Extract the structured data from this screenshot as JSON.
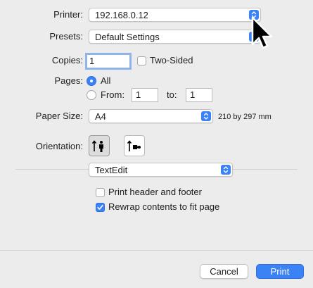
{
  "printer": {
    "label": "Printer:",
    "value": "192.168.0.12"
  },
  "presets": {
    "label": "Presets:",
    "value": "Default Settings"
  },
  "copies": {
    "label": "Copies:",
    "value": "1",
    "two_sided_label": "Two-Sided",
    "two_sided_checked": false
  },
  "pages": {
    "label": "Pages:",
    "all_label": "All",
    "from_label": "From:",
    "from_value": "1",
    "to_label": "to:",
    "to_value": "1",
    "selected": "All"
  },
  "paper_size": {
    "label": "Paper Size:",
    "value": "A4",
    "dimensions": "210 by 297 mm"
  },
  "orientation": {
    "label": "Orientation:",
    "selected": "portrait",
    "options": [
      "portrait",
      "landscape"
    ]
  },
  "app_section": {
    "value": "TextEdit"
  },
  "options": [
    {
      "label": "Print header and footer",
      "checked": false
    },
    {
      "label": "Rewrap contents to fit page",
      "checked": true
    }
  ],
  "buttons": {
    "cancel": "Cancel",
    "print": "Print"
  },
  "colors": {
    "accent": "#3b82f7",
    "background": "#ececec"
  }
}
